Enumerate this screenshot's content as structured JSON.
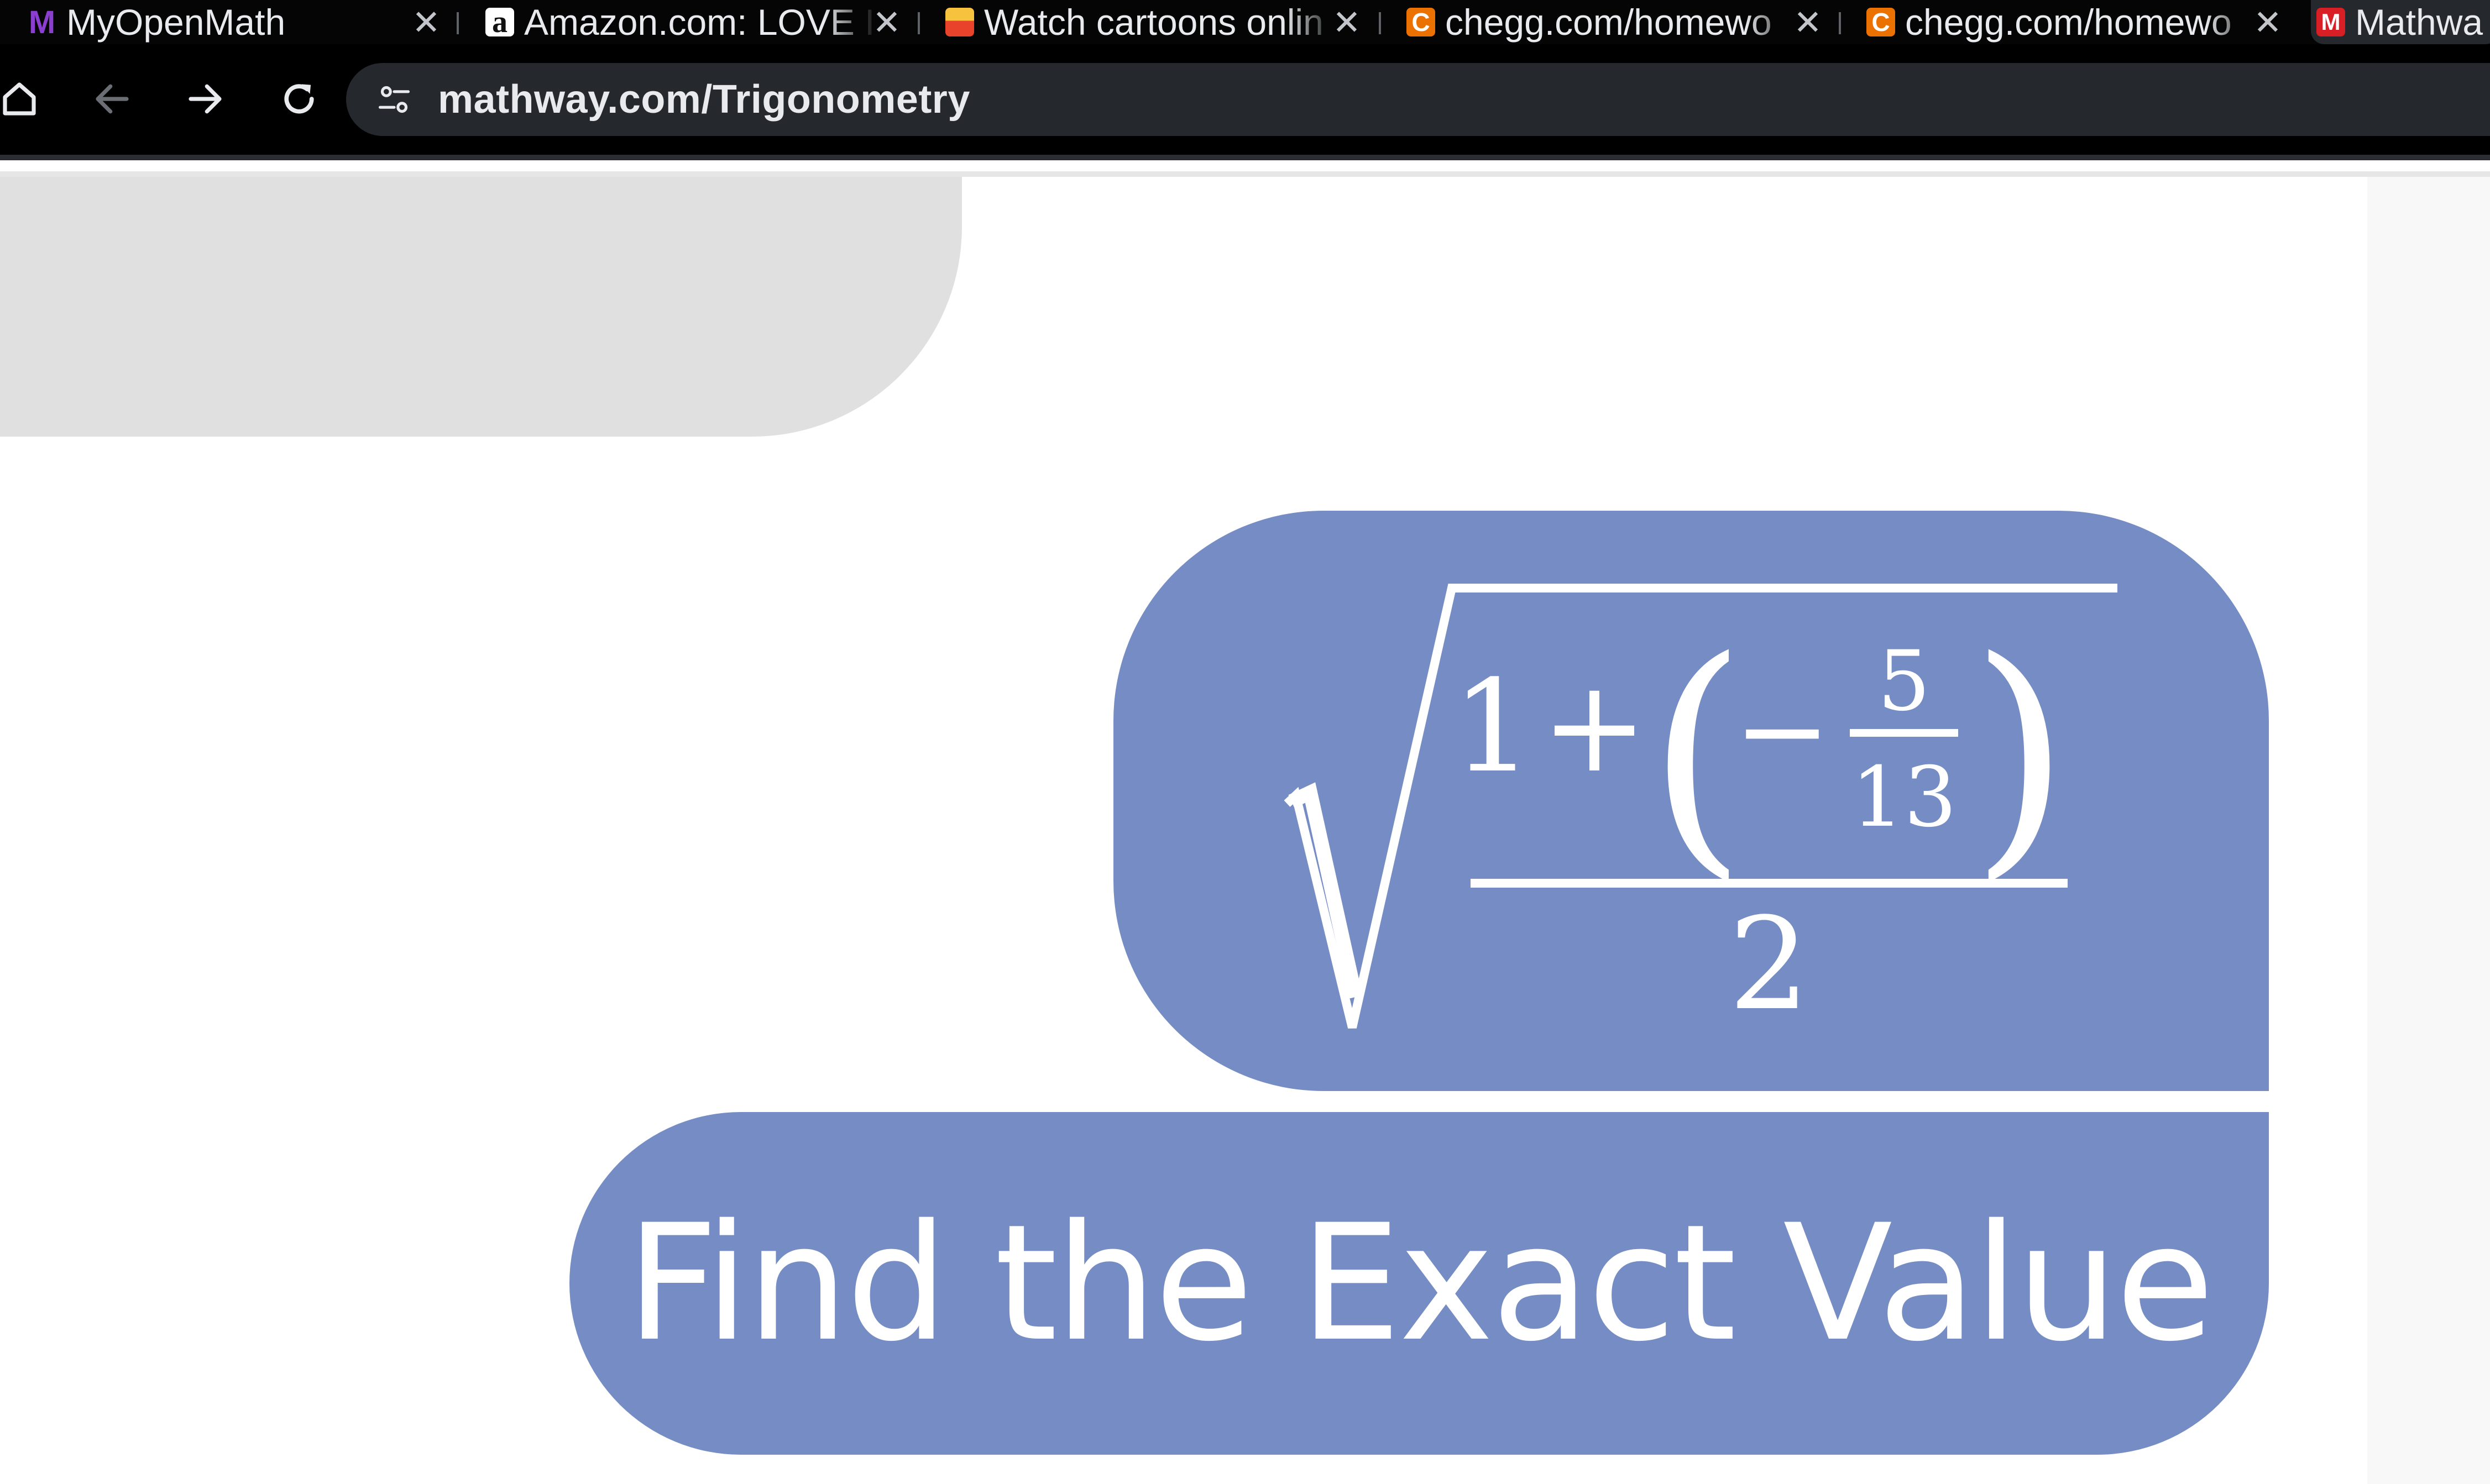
{
  "browser": {
    "tabs": [
      {
        "title": "MyOpenMath",
        "favicon": "myopenmath-icon"
      },
      {
        "title": "Amazon.com: LOVE I",
        "favicon": "amazon-icon"
      },
      {
        "title": "Watch cartoons onlin",
        "favicon": "cartoon-icon"
      },
      {
        "title": "chegg.com/homewo",
        "favicon": "chegg-icon"
      },
      {
        "title": "chegg.com/homewo",
        "favicon": "chegg-icon"
      },
      {
        "title": "Mathwa",
        "favicon": "mathway-icon",
        "active": true
      }
    ],
    "tab_close_glyph": "✕",
    "address": "mathway.com/Trigonometry"
  },
  "problem": {
    "expression": {
      "numerator_whole": "1",
      "plus": "+",
      "open_paren": "(",
      "minus": "−",
      "fraction_numerator": "5",
      "fraction_denominator": "13",
      "close_paren": ")",
      "denominator": "2"
    },
    "action": "Find the Exact Value"
  },
  "colors": {
    "bubble": "#758dc4",
    "bubble_text": "#ffffff",
    "gray_bubble": "#e0e0e0"
  }
}
